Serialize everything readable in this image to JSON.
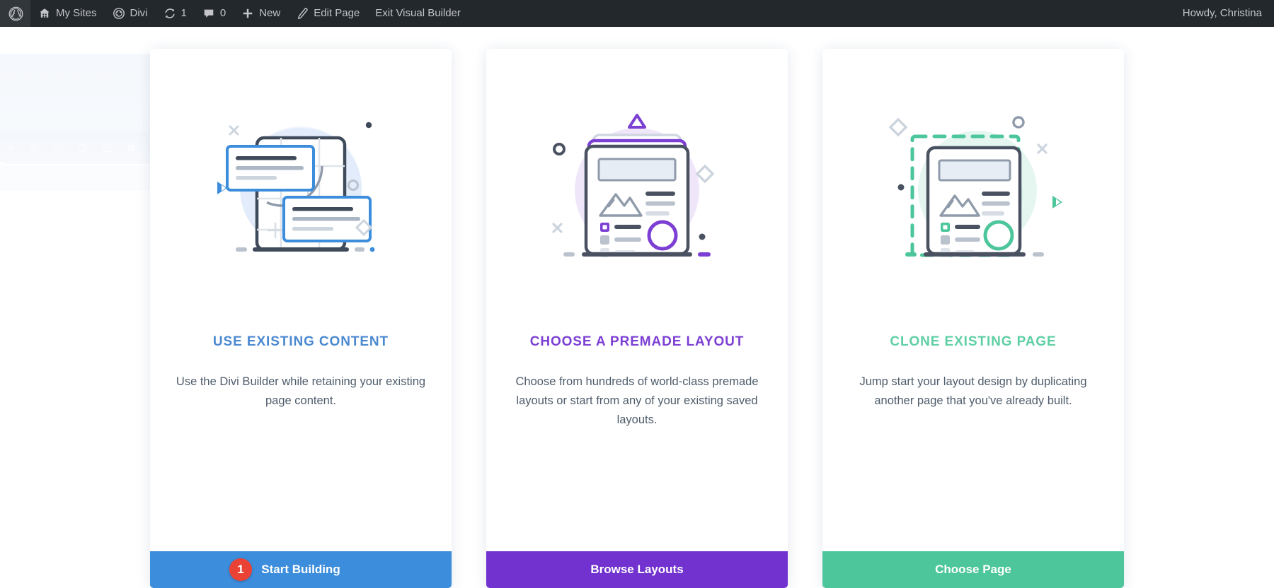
{
  "adminbar": {
    "logo_icon": "wordpress-logo-icon",
    "items": [
      {
        "icon": "sites-icon",
        "label": "My Sites"
      },
      {
        "icon": "divi-icon",
        "label": "Divi"
      },
      {
        "icon": "updates-icon",
        "label": "1"
      },
      {
        "icon": "comments-icon",
        "label": "0"
      },
      {
        "icon": "plus-icon",
        "label": "New"
      },
      {
        "icon": "pencil-icon",
        "label": "Edit Page"
      },
      {
        "icon": "",
        "label": "Exit Visual Builder"
      }
    ],
    "howdy": "Howdy, Christina"
  },
  "ghost_toolbar": {
    "icons": [
      "plus-icon",
      "refresh-icon",
      "save-icon",
      "clock-icon",
      "list-icon",
      "wrench-icon",
      "dots-icon"
    ]
  },
  "cards": [
    {
      "id": "use-existing-content",
      "illustration": "blue-wireframe-illustration",
      "title": "USE EXISTING CONTENT",
      "title_color": "#4b89d0",
      "description": "Use the Divi Builder while retaining your existing page content.",
      "button_label": "Start Building",
      "button_color": "#3c8ddb",
      "badge": "1",
      "badge_color": "#ea4335"
    },
    {
      "id": "choose-premade-layout",
      "illustration": "purple-layout-illustration",
      "title": "CHOOSE A PREMADE LAYOUT",
      "title_color": "#7c3fd4",
      "description": "Choose from hundreds of world-class premade layouts or start from any of your existing saved layouts.",
      "button_label": "Browse Layouts",
      "button_color": "#7232cf",
      "badge": "",
      "badge_color": ""
    },
    {
      "id": "clone-existing-page",
      "illustration": "green-clone-illustration",
      "title": "CLONE EXISTING PAGE",
      "title_color": "#5ecfa4",
      "description": "Jump start your layout design by duplicating another page that you've already built.",
      "button_label": "Choose Page",
      "button_color": "#4dc69b",
      "badge": "",
      "badge_color": ""
    }
  ]
}
